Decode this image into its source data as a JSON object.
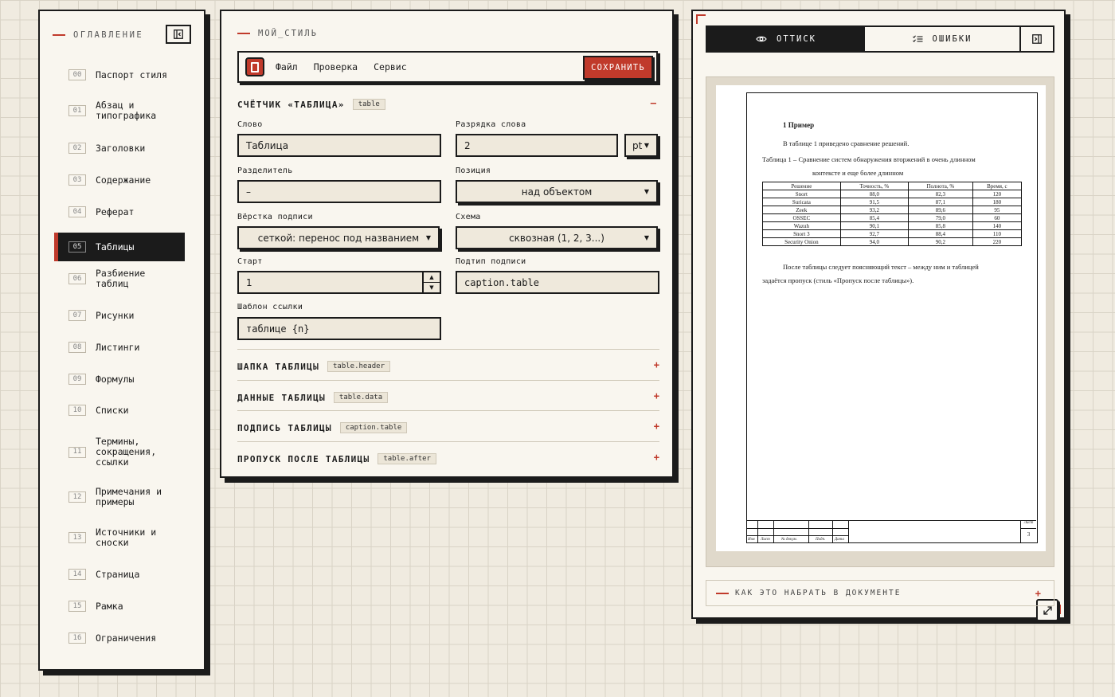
{
  "toc": {
    "heading": "ОГЛАВЛЕНИЕ",
    "items": [
      {
        "num": "00",
        "label": "Паспорт стиля"
      },
      {
        "num": "01",
        "label": "Абзац и типографика"
      },
      {
        "num": "02",
        "label": "Заголовки"
      },
      {
        "num": "03",
        "label": "Содержание"
      },
      {
        "num": "04",
        "label": "Реферат"
      },
      {
        "num": "05",
        "label": "Таблицы"
      },
      {
        "num": "06",
        "label": "Разбиение таблиц"
      },
      {
        "num": "07",
        "label": "Рисунки"
      },
      {
        "num": "08",
        "label": "Листинги"
      },
      {
        "num": "09",
        "label": "Формулы"
      },
      {
        "num": "10",
        "label": "Списки"
      },
      {
        "num": "11",
        "label": "Термины, сокращения, ссылки"
      },
      {
        "num": "12",
        "label": "Примечания и примеры"
      },
      {
        "num": "13",
        "label": "Источники и сноски"
      },
      {
        "num": "14",
        "label": "Страница"
      },
      {
        "num": "15",
        "label": "Рамка"
      },
      {
        "num": "16",
        "label": "Ограничения"
      }
    ],
    "active_index": 5
  },
  "editor": {
    "style_name": "МОЙ_СТИЛЬ",
    "menu": [
      "Файл",
      "Проверка",
      "Сервис"
    ],
    "save_label": "СОХРАНИТЬ",
    "section": {
      "title": "СЧЁТЧИК «ТАБЛИЦА»",
      "tag": "table",
      "toggle": "–"
    },
    "fields": {
      "word_label": "Слово",
      "word_value": "Таблица",
      "word_spacing_label": "Разрядка слова",
      "word_spacing_value": "2",
      "word_spacing_unit": "pt",
      "separator_label": "Разделитель",
      "separator_value": "–",
      "position_label": "Позиция",
      "position_value": "над объектом",
      "layout_label": "Вёрстка подписи",
      "layout_value": "сеткой: перенос под названием",
      "scheme_label": "Схема",
      "scheme_value": "сквозная (1, 2, 3...)",
      "start_label": "Старт",
      "start_value": "1",
      "subtype_label": "Подтип подписи",
      "subtype_value": "caption.table",
      "ref_template_label": "Шаблон ссылки",
      "ref_template_value": "таблице {n}"
    },
    "accordions": [
      {
        "title": "ШАПКА ТАБЛИЦЫ",
        "tag": "table.header",
        "toggle": "+"
      },
      {
        "title": "ДАННЫЕ ТАБЛИЦЫ",
        "tag": "table.data",
        "toggle": "+"
      },
      {
        "title": "ПОДПИСЬ ТАБЛИЦЫ",
        "tag": "caption.table",
        "toggle": "+"
      },
      {
        "title": "ПРОПУСК ПОСЛЕ ТАБЛИЦЫ",
        "tag": "table.after",
        "toggle": "+"
      }
    ]
  },
  "preview": {
    "tab_print": "ОТТИСК",
    "tab_errors": "ОШИБКИ",
    "howto": "КАК ЭТО НАБРАТЬ В ДОКУМЕНТЕ",
    "howto_toggle": "+",
    "doc": {
      "heading": "1 Пример",
      "intro": "В таблице 1 приведено сравнение решений.",
      "caption_line1": "Таблица 1 – Сравнение систем обнаружения вторжений в очень длинном",
      "caption_line2": "контексте и еще более длинном",
      "table_headers": [
        "Решение",
        "Точность, %",
        "Полнота, %",
        "Время, с"
      ],
      "table_rows": [
        [
          "Snort",
          "88,0",
          "82,3",
          "120"
        ],
        [
          "Suricata",
          "91,5",
          "87,1",
          "180"
        ],
        [
          "Zeek",
          "93,2",
          "89,6",
          "95"
        ],
        [
          "OSSEC",
          "85,4",
          "79,0",
          "60"
        ],
        [
          "Wazuh",
          "90,1",
          "85,8",
          "140"
        ],
        [
          "Snort 3",
          "92,7",
          "88,4",
          "110"
        ],
        [
          "Security Onion",
          "94,0",
          "90,2",
          "220"
        ]
      ],
      "after_line1": "После таблицы следует поясняющий текст – между ним и таблицей",
      "after_line2": "задаётся пропуск (стиль «Пропуск после таблицы»).",
      "stamp_labels": [
        "Изм",
        "Лист",
        "№ докум.",
        "Подп.",
        "Дата"
      ],
      "stamp_sheet": "Лист",
      "stamp_sheet_num": "3"
    }
  }
}
